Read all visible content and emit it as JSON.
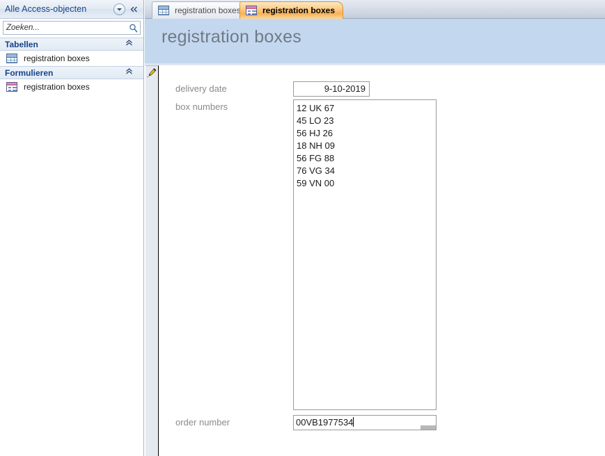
{
  "nav_pane": {
    "header_title": "Alle Access-objecten",
    "dropdown_icon": "chevron-down-circle-icon",
    "collapse_icon": "double-chevron-left-icon",
    "search": {
      "placeholder": "Zoeken...",
      "value": "",
      "icon": "search-icon"
    },
    "groups": [
      {
        "label": "Tabellen",
        "chevron_icon": "double-chevron-up-icon",
        "items": [
          {
            "label": "registration boxes",
            "icon": "table-icon"
          }
        ]
      },
      {
        "label": "Formulieren",
        "chevron_icon": "double-chevron-up-icon",
        "items": [
          {
            "label": "registration boxes",
            "icon": "form-icon"
          }
        ]
      }
    ]
  },
  "tabs": [
    {
      "label": "registration boxes",
      "icon": "table-icon",
      "active": false
    },
    {
      "label": "registration boxes",
      "icon": "form-icon",
      "active": true
    }
  ],
  "form": {
    "title": "registration boxes",
    "record_selector_icon": "pencil-edit-icon",
    "fields": [
      {
        "label": "delivery date",
        "value": "9-10-2019",
        "type": "textbox",
        "align": "right"
      },
      {
        "label": "box numbers",
        "value": "12 UK 67\n45 LO 23\n56 HJ 26\n18 NH 09\n56 FG 88\n76 VG 34\n59 VN 00",
        "type": "textarea",
        "align": "left"
      },
      {
        "label": "order number",
        "value": "00VB1977534",
        "type": "textbox",
        "align": "left",
        "focused": true
      }
    ]
  },
  "colors": {
    "form_header_band": "#c3d8ef",
    "nav_header_text": "#15428b",
    "active_tab": "#f8b159",
    "field_label_text": "#8a8a8a",
    "form_title_text": "#6f7a87",
    "record_selector_bg": "#e4e9f2"
  }
}
